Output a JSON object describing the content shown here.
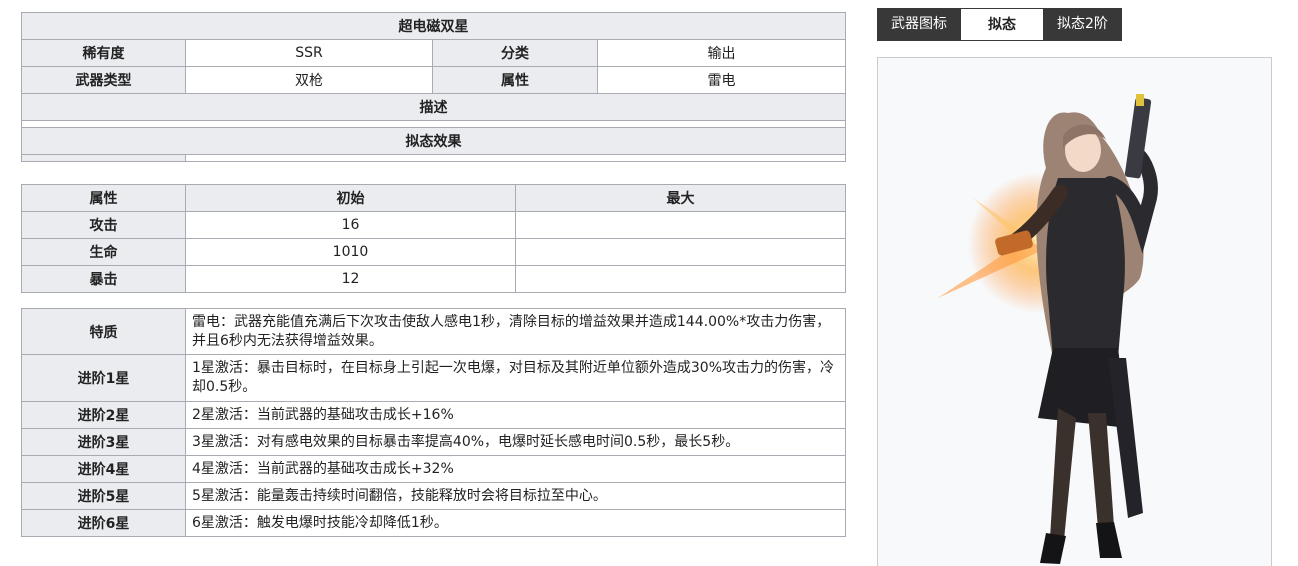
{
  "weapon": {
    "name": "超电磁双星",
    "labels": {
      "rarity": "稀有度",
      "category": "分类",
      "type": "武器类型",
      "element": "属性",
      "description": "描述",
      "mimicry_effect": "拟态效果"
    },
    "rarity": "SSR",
    "category": "输出",
    "type": "双枪",
    "element": "雷电"
  },
  "stats": {
    "headers": [
      "属性",
      "初始",
      "最大"
    ],
    "rows": [
      {
        "name": "攻击",
        "initial": "16",
        "max": ""
      },
      {
        "name": "生命",
        "initial": "1010",
        "max": ""
      },
      {
        "name": "暴击",
        "initial": "12",
        "max": ""
      }
    ]
  },
  "traits": [
    {
      "label": "特质",
      "text": "雷电：武器充能值充满后下次攻击使敌人感电1秒，清除目标的增益效果并造成144.00%*攻击力伤害，并且6秒内无法获得增益效果。"
    },
    {
      "label": "进阶1星",
      "text": "1星激活：暴击目标时，在目标身上引起一次电爆，对目标及其附近单位额外造成30%攻击力的伤害，冷却0.5秒。"
    },
    {
      "label": "进阶2星",
      "text": "2星激活：当前武器的基础攻击成长+16%"
    },
    {
      "label": "进阶3星",
      "text": "3星激活：对有感电效果的目标暴击率提高40%，电爆时延长感电时间0.5秒，最长5秒。"
    },
    {
      "label": "进阶4星",
      "text": "4星激活：当前武器的基础攻击成长+32%"
    },
    {
      "label": "进阶5星",
      "text": "5星激活：能量轰击持续时间翻倍，技能释放时会将目标拉至中心。"
    },
    {
      "label": "进阶6星",
      "text": "6星激活：触发电爆时技能冷却降低1秒。"
    }
  ],
  "tabs": [
    "武器图标",
    "拟态",
    "拟态2阶"
  ],
  "colors": {
    "header_bg": "#eaecf0",
    "border": "#a8abb2",
    "tab_dark": "#383838"
  }
}
